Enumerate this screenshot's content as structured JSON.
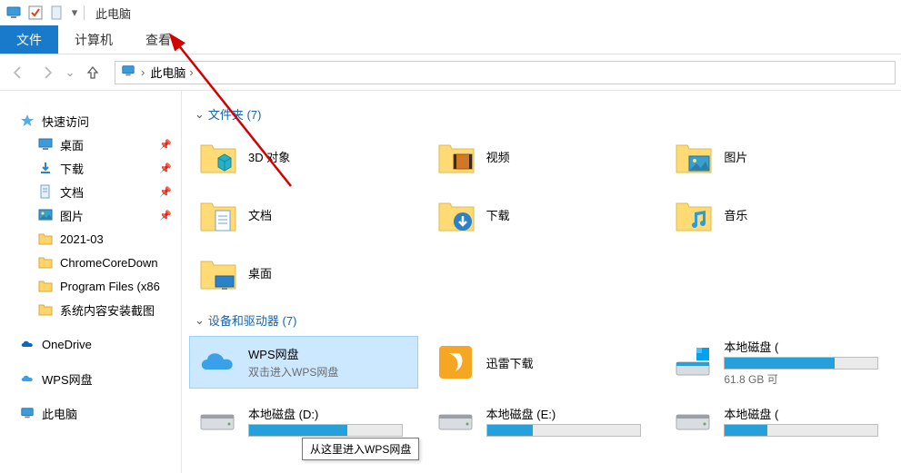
{
  "window": {
    "title": "此电脑",
    "title_sep": "|"
  },
  "ribbon": {
    "file": "文件",
    "computer": "计算机",
    "view": "查看"
  },
  "breadcrumb": {
    "loc": "此电脑",
    "chev": "›"
  },
  "sidebar": {
    "quick": {
      "label": "快速访问",
      "items": [
        {
          "label": "桌面",
          "icon": "desktop",
          "pinned": true
        },
        {
          "label": "下载",
          "icon": "downloads",
          "pinned": true
        },
        {
          "label": "文档",
          "icon": "documents",
          "pinned": true
        },
        {
          "label": "图片",
          "icon": "pictures",
          "pinned": true
        },
        {
          "label": "2021-03",
          "icon": "folder",
          "pinned": false
        },
        {
          "label": "ChromeCoreDown",
          "icon": "folder",
          "pinned": false
        },
        {
          "label": "Program Files (x86",
          "icon": "folder",
          "pinned": false
        },
        {
          "label": "系统内容安装截图",
          "icon": "folder",
          "pinned": false
        }
      ]
    },
    "onedrive": "OneDrive",
    "wps": "WPS网盘",
    "thispc": "此电脑"
  },
  "groups": {
    "folders": {
      "header": "文件夹 (7)",
      "items": [
        {
          "name": "3D 对象",
          "icon": "3d"
        },
        {
          "name": "视频",
          "icon": "videos"
        },
        {
          "name": "图片",
          "icon": "pictures"
        },
        {
          "name": "文档",
          "icon": "documents"
        },
        {
          "name": "下载",
          "icon": "downloads"
        },
        {
          "name": "音乐",
          "icon": "music"
        },
        {
          "name": "桌面",
          "icon": "desktop"
        }
      ]
    },
    "devices": {
      "header": "设备和驱动器 (7)",
      "items": [
        {
          "name": "WPS网盘",
          "sub": "双击进入WPS网盘",
          "icon": "wps",
          "selected": true
        },
        {
          "name": "迅雷下载",
          "icon": "xunlei"
        },
        {
          "name": "本地磁盘 (",
          "icon": "drive-c",
          "bar_pct": 72,
          "subline": "61.8 GB 可"
        },
        {
          "name": "本地磁盘 (D:)",
          "icon": "drive",
          "bar_pct": 64
        },
        {
          "name": "本地磁盘 (E:)",
          "icon": "drive",
          "bar_pct": 30
        },
        {
          "name": "本地磁盘 (",
          "icon": "drive",
          "bar_pct": 28
        }
      ]
    }
  },
  "tooltip": "从这里进入WPS网盘"
}
